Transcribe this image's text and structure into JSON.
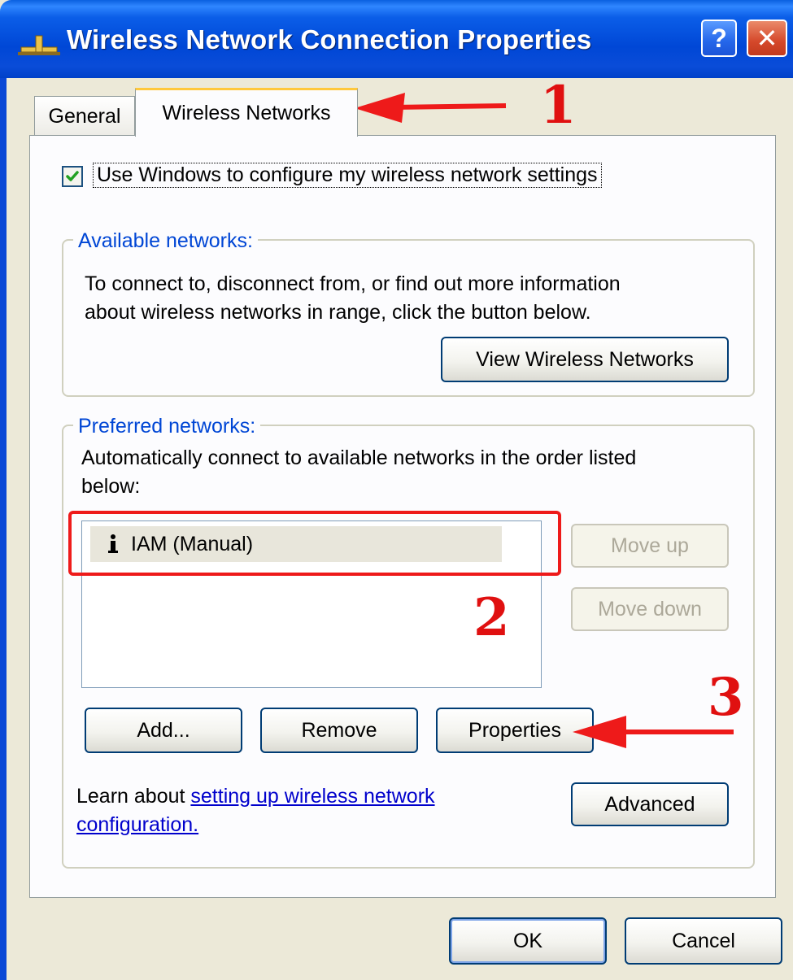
{
  "window": {
    "title": "Wireless Network Connection Properties",
    "help_label": "?",
    "close_label": "✕"
  },
  "tabs": [
    {
      "label": "General",
      "active": false
    },
    {
      "label": "Wireless Networks",
      "active": true
    }
  ],
  "use_windows_checkbox": {
    "label": "Use Windows to configure my wireless network settings",
    "checked": true
  },
  "available_networks": {
    "legend": "Available networks:",
    "description_line1": "To connect to, disconnect from, or find out more information",
    "description_line2": "about wireless networks in range, click the button below.",
    "view_button": "View Wireless Networks"
  },
  "preferred_networks": {
    "legend": "Preferred networks:",
    "description_line1": "Automatically connect to available networks in the order listed",
    "description_line2": "below:",
    "items": [
      {
        "name": "IAM (Manual)",
        "icon": "manual-network-icon"
      }
    ],
    "move_up_button": "Move up",
    "move_down_button": "Move down",
    "add_button": "Add...",
    "remove_button": "Remove",
    "properties_button": "Properties"
  },
  "learn": {
    "prefix": "Learn about ",
    "link_line1": "setting up wireless network",
    "link_line2": "configuration."
  },
  "advanced_button": "Advanced",
  "ok_button": "OK",
  "cancel_button": "Cancel",
  "annotations": {
    "step1": "1",
    "step2": "2",
    "step3": "3",
    "color": "#e01010"
  },
  "colors": {
    "titlebar": "#0047d6",
    "dialog_bg": "#ece9d8",
    "legend_text": "#0046d5",
    "tab_highlight": "#ffc83c"
  }
}
